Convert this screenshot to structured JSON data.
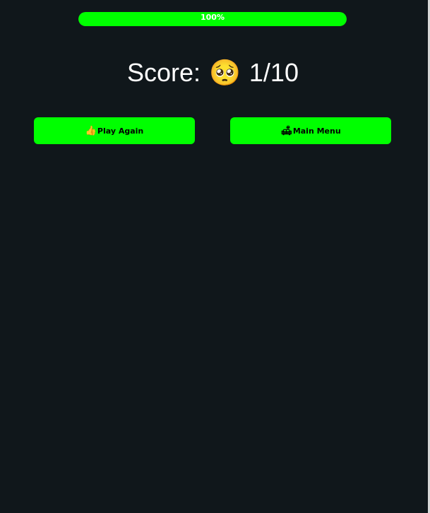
{
  "progress": {
    "label": "100%",
    "value": 1.0,
    "fill_color": "#00ff00"
  },
  "score": {
    "prefix": "Score:",
    "emoji": "🥺",
    "value": "1/10"
  },
  "buttons": {
    "play_again": {
      "icon": "👍",
      "icon_name": "thumbs-up-icon",
      "label": "Play Again"
    },
    "main_menu": {
      "icon": "🛋",
      "icon_name": "couch-icon",
      "label": "Main Menu"
    }
  },
  "colors": {
    "background": "#10171b",
    "accent": "#00ff00",
    "text": "#ffffff"
  }
}
